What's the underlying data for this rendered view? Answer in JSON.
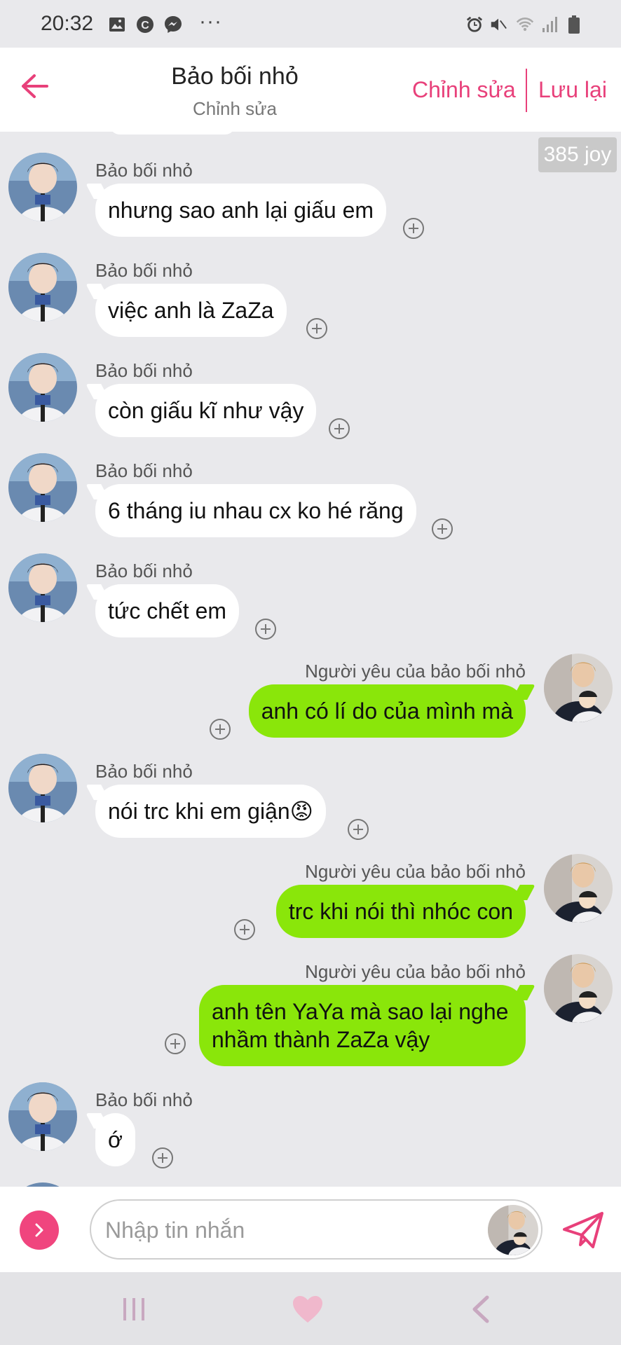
{
  "status_bar": {
    "time": "20:32",
    "icons": [
      "image-icon",
      "c-icon",
      "messenger-icon",
      "more-dots-icon",
      "alarm-icon",
      "mute-icon",
      "wifi-icon",
      "signal-icon",
      "battery-icon"
    ],
    "dots": "···"
  },
  "header": {
    "title": "Bảo bối nhỏ",
    "subtitle": "Chỉnh sửa",
    "edit_label": "Chỉnh sửa",
    "save_label": "Lưu lại",
    "accent_color": "#e8407a"
  },
  "joy_badge": "385 joy",
  "messages": [
    {
      "side": "in",
      "sender": "Bảo bối nhỏ",
      "text": "nhưng sao anh lại giấu em"
    },
    {
      "side": "in",
      "sender": "Bảo bối nhỏ",
      "text": "việc anh là ZaZa"
    },
    {
      "side": "in",
      "sender": "Bảo bối nhỏ",
      "text": "còn giấu kĩ như vậy"
    },
    {
      "side": "in",
      "sender": "Bảo bối nhỏ",
      "text": "6 tháng iu nhau cx ko hé răng"
    },
    {
      "side": "in",
      "sender": "Bảo bối nhỏ",
      "text": "tức chết em"
    },
    {
      "side": "out",
      "sender": "Người yêu của bảo bối nhỏ",
      "text": "anh có lí do của mình mà"
    },
    {
      "side": "in",
      "sender": "Bảo bối nhỏ",
      "text": "nói trc khi em giận😡"
    },
    {
      "side": "out",
      "sender": "Người yêu của bảo bối nhỏ",
      "text": "trc khi nói thì nhóc con"
    },
    {
      "side": "out",
      "sender": "Người yêu của bảo bối nhỏ",
      "text": "anh tên YaYa mà sao lại nghe nhầm thành ZaZa vậy"
    },
    {
      "side": "in",
      "sender": "Bảo bối nhỏ",
      "text": "ớ"
    }
  ],
  "composer": {
    "placeholder": "Nhập tin nhắn",
    "value": ""
  },
  "colors": {
    "incoming_bubble": "#ffffff",
    "outgoing_bubble": "#8ae60a",
    "background": "#e9e9ec"
  },
  "navbar": [
    "recent-apps-icon",
    "heart-home-icon",
    "back-icon"
  ]
}
